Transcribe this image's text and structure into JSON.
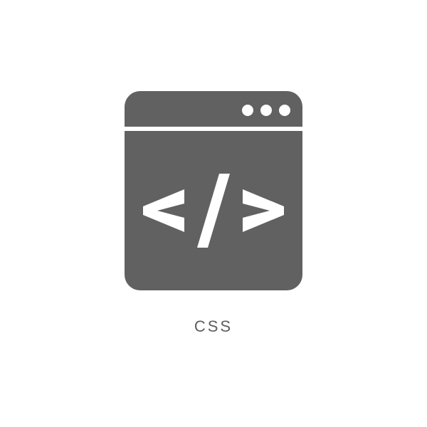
{
  "icon": {
    "name": "css-code-window-icon",
    "fill": "#616161"
  },
  "label": "CSS"
}
